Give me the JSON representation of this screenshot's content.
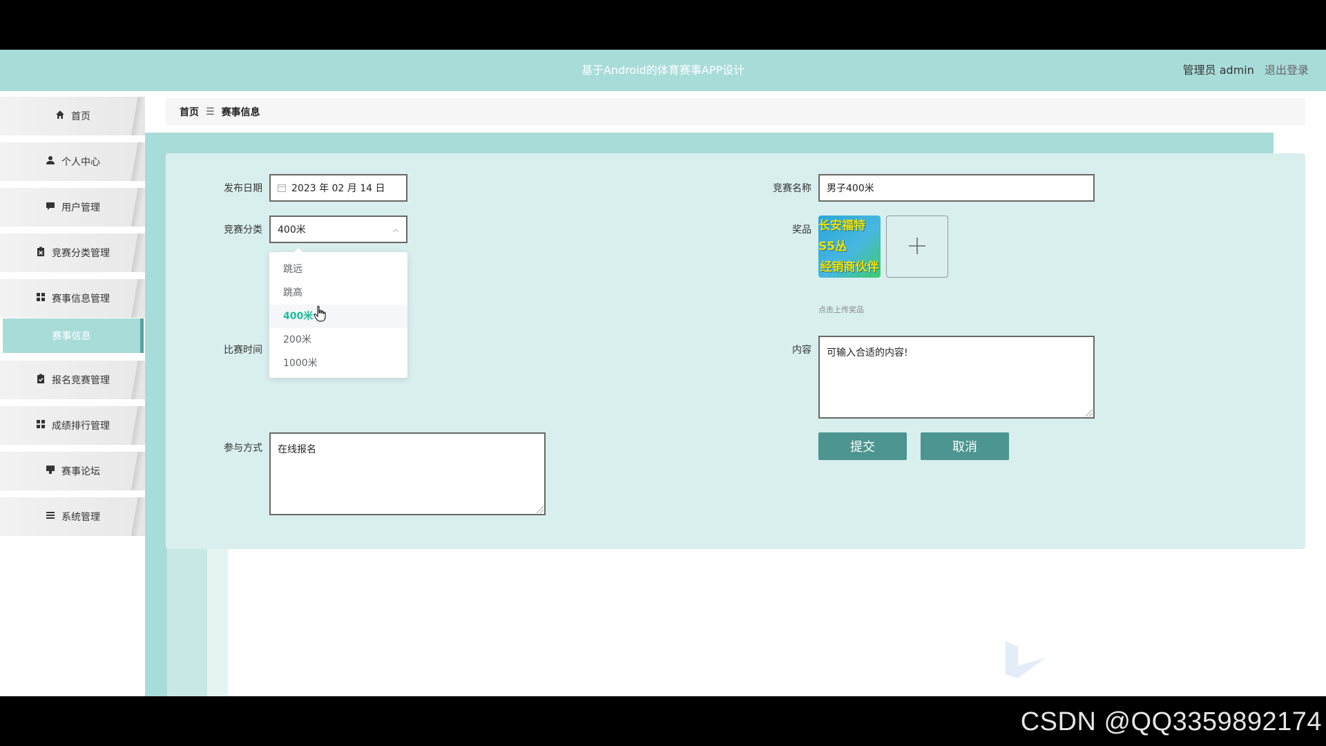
{
  "header": {
    "title": "基于Android的体育赛事APP设计",
    "admin_label": "管理员 admin",
    "logout_label": "退出登录"
  },
  "sidebar": {
    "items": [
      {
        "label": "首页",
        "icon": "home-icon"
      },
      {
        "label": "个人中心",
        "icon": "user-icon"
      },
      {
        "label": "用户管理",
        "icon": "chat-icon"
      },
      {
        "label": "竞赛分类管理",
        "icon": "clipboard-x-icon"
      },
      {
        "label": "赛事信息管理",
        "icon": "grid-icon"
      },
      {
        "label": "报名竞赛管理",
        "icon": "clipboard-check-icon"
      },
      {
        "label": "成绩排行管理",
        "icon": "grid-icon"
      },
      {
        "label": "赛事论坛",
        "icon": "forum-icon"
      },
      {
        "label": "系统管理",
        "icon": "list-icon"
      }
    ],
    "active_submenu": "赛事信息"
  },
  "breadcrumb": {
    "home": "首页",
    "separator": "☰",
    "current": "赛事信息"
  },
  "form": {
    "publish_date_label": "发布日期",
    "publish_date_value": "2023 年 02 月 14 日",
    "category_label": "竞赛分类",
    "category_value": "400米",
    "category_options": [
      "跳远",
      "跳高",
      "400米",
      "200米",
      "1000米"
    ],
    "match_time_label": "比赛时间",
    "participation_label": "参与方式",
    "participation_value": "在线报名",
    "event_name_label": "竞赛名称",
    "event_name_value": "男子400米",
    "prize_label": "奖品",
    "prize_image_text": [
      "长安福特S5丛",
      "经销商伙伴"
    ],
    "upload_hint": "点击上传奖品",
    "content_label": "内容",
    "content_value": "可输入合适的内容!",
    "submit_label": "提交",
    "cancel_label": "取消"
  },
  "watermark": "CSDN @QQ3359892174",
  "colors": {
    "header_bg": "#a8dcd9",
    "panel_bg": "#d9efee",
    "button_bg": "#4c9590",
    "selected_option": "#1bbf9a"
  }
}
